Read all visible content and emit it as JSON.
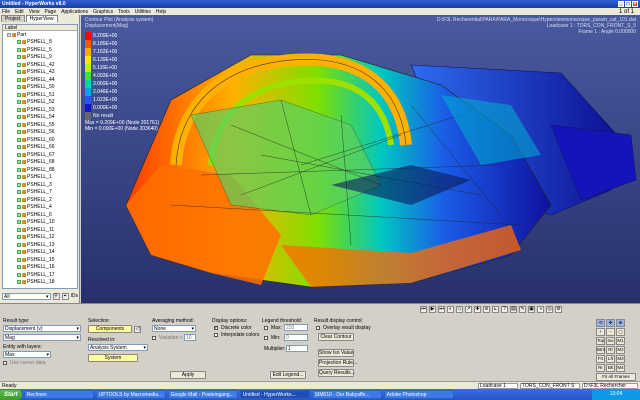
{
  "window": {
    "title": "Untitled - HyperWorks v8.0",
    "controls": [
      "_",
      "□",
      "×"
    ]
  },
  "menu": {
    "items": [
      "File",
      "Edit",
      "View",
      "Page",
      "Applications",
      "Graphics",
      "Tools",
      "Utilities",
      "Help"
    ],
    "page_count": "1 of 1"
  },
  "left_panel": {
    "tabs": [
      "Project",
      "HyperView"
    ],
    "tree_header": "Label",
    "root": "Part",
    "items": [
      "PSHELL_8",
      "PSHELL_5",
      "PSHELL_9",
      "PSHELL_42",
      "PSHELL_43",
      "PSHELL_44",
      "PSHELL_50",
      "PSHELL_51",
      "PSHELL_52",
      "PSHELL_53",
      "PSHELL_54",
      "PSHELL_55",
      "PSHELL_56",
      "PSHELL_60",
      "PSHELL_66",
      "PSHELL_67",
      "PSHELL_68",
      "PSHELL_88",
      "PSHELL_1",
      "PSHELL_3",
      "PSHELL_7",
      "PSHELL_2",
      "PSHELL_4",
      "PSHELL_6",
      "PSHELL_10",
      "PSHELL_11",
      "PSHELL_12",
      "PSHELL_13",
      "PSHELL_14",
      "PSHELL_15",
      "PSHELL_16",
      "PSHELL_17",
      "PSHELL_18"
    ],
    "filter_value": "All",
    "id_label": "IDs"
  },
  "viewport": {
    "info_lines": [
      "Contour Plot (Analysis system)",
      "Displacement(Mag)"
    ],
    "legend": {
      "values": [
        "9.209E+00",
        "8.185E+00",
        "7.162E+00",
        "6.139E+00",
        "5.116E+00",
        "4.093E+00",
        "3.069E+00",
        "2.046E+00",
        "1.023E+00",
        "0.000E+00"
      ],
      "no_result": "No result",
      "colors": [
        "#ff0000",
        "#ff5a00",
        "#ffa800",
        "#ffe600",
        "#b7f500",
        "#38e53a",
        "#00d8a8",
        "#00a6e8",
        "#2a55f0",
        "#1414c8"
      ],
      "max_line": "Max = 9.209E+00 (Node 201761)",
      "min_line": "Min = 0.000E+00 (Node 203640)"
    },
    "right_lines": [
      "D:\\F3L Recherential\\PARA\\PARA_Monocoque\\Hyperviewmonocoque_param_cat_101.dat",
      "Loadcase 1 : TORS_CON_FRONT_S_5",
      "Frame 1 : Angle 0.000000"
    ]
  },
  "panel": {
    "result_type_label": "Result type:",
    "result_type_value": "Displacement (v)",
    "result_comp_value": "Mag",
    "entity_label": "Entity with layers:",
    "entity_value": "Max",
    "use_corner_label": "Use corner data",
    "selection_label": "Selection:",
    "components_btn": "Components",
    "resolved_label": "Resolved in:",
    "resolved_value": "Analysis System",
    "system_btn": "System",
    "averaging_label": "Averaging method:",
    "averaging_value": "None",
    "variation_label": "Variation <",
    "variation_value": "10",
    "apply_btn": "Apply",
    "display_options_label": "Display options:",
    "discrete_color_label": "Discrete color",
    "interpolate_label": "Interpolate colors",
    "legend_threshold_label": "Legend threshold:",
    "max_label": "Max:",
    "max_value": "220",
    "min_label": "Min:",
    "min_value": "0",
    "multiplier_label": "Multiplier:",
    "multiplier_value": "1",
    "edit_legend_btn": "Edit Legend...",
    "result_display_label": "Result display control:",
    "overlay_label": "Overlay result display",
    "clear_contour_btn": "Clear Contour",
    "show_iso_btn": "Show Iso Value",
    "projection_btn": "Projection Rule...",
    "query_btn": "Query Results...",
    "view_buttons": [
      "Top",
      "Iso",
      "M1",
      "Btm",
      "Rt",
      "M2",
      "Frt",
      "Lft",
      "M3",
      "Rr",
      "Bk",
      "M4"
    ],
    "fit_all_btn": "Fit All Frames"
  },
  "status": {
    "left": "Ready",
    "loadcase": "Loadcase 1",
    "loadcase_name": "TORS_CON_FRONT S",
    "path": "D:\\F3L Rechercher"
  },
  "taskbar": {
    "start": "Start",
    "tasks": [
      "Rechnen",
      "UPTOOLS by Macromedia...",
      "Google Mail - Posteingang...",
      "Untitled - HyperWorks...",
      "SIM010 - Der Babyaffe...",
      "Adobe Photoshop"
    ],
    "time": "13:04"
  }
}
